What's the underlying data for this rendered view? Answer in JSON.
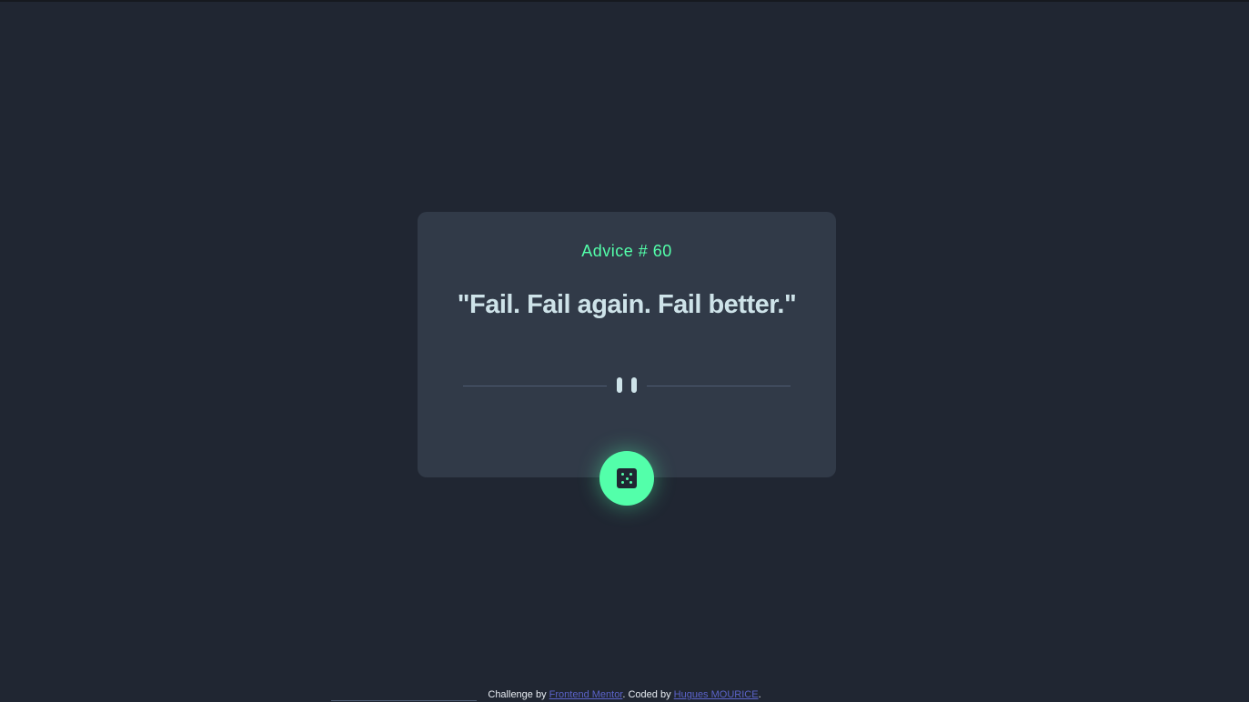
{
  "advice": {
    "id_label": "Advice # 60",
    "text": "\"Fail. Fail again. Fail better.\""
  },
  "divider": {
    "icon": "pause-icon"
  },
  "action": {
    "icon": "dice-icon"
  },
  "footer": {
    "prefix": "Challenge by ",
    "challenge_link": "Frontend Mentor",
    "middle": ". Coded by ",
    "author_link": "Hugues MOURICE",
    "suffix": "."
  },
  "colors": {
    "background": "#202632",
    "card": "#313a48",
    "accent": "#53ffaa",
    "text": "#cee3e9",
    "link": "#5b63c9"
  }
}
